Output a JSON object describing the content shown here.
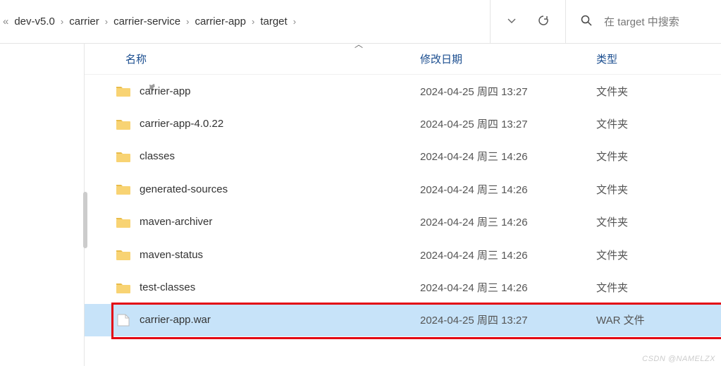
{
  "breadcrumb": {
    "items": [
      "dev-v5.0",
      "carrier",
      "carrier-service",
      "carrier-app",
      "target"
    ]
  },
  "search": {
    "placeholder": "在 target 中搜索"
  },
  "columns": {
    "name": "名称",
    "date": "修改日期",
    "type": "类型"
  },
  "rows": [
    {
      "name": "carrier-app",
      "date": "2024-04-25 周四 13:27",
      "type": "文件夹",
      "kind": "folder",
      "selected": false
    },
    {
      "name": "carrier-app-4.0.22",
      "date": "2024-04-25 周四 13:27",
      "type": "文件夹",
      "kind": "folder",
      "selected": false
    },
    {
      "name": "classes",
      "date": "2024-04-24 周三 14:26",
      "type": "文件夹",
      "kind": "folder",
      "selected": false
    },
    {
      "name": "generated-sources",
      "date": "2024-04-24 周三 14:26",
      "type": "文件夹",
      "kind": "folder",
      "selected": false
    },
    {
      "name": "maven-archiver",
      "date": "2024-04-24 周三 14:26",
      "type": "文件夹",
      "kind": "folder",
      "selected": false
    },
    {
      "name": "maven-status",
      "date": "2024-04-24 周三 14:26",
      "type": "文件夹",
      "kind": "folder",
      "selected": false
    },
    {
      "name": "test-classes",
      "date": "2024-04-24 周三 14:26",
      "type": "文件夹",
      "kind": "folder",
      "selected": false
    },
    {
      "name": "carrier-app.war",
      "date": "2024-04-25 周四 13:27",
      "type": "WAR 文件",
      "kind": "file",
      "selected": true
    }
  ],
  "watermark": "CSDN @NAMELZX"
}
